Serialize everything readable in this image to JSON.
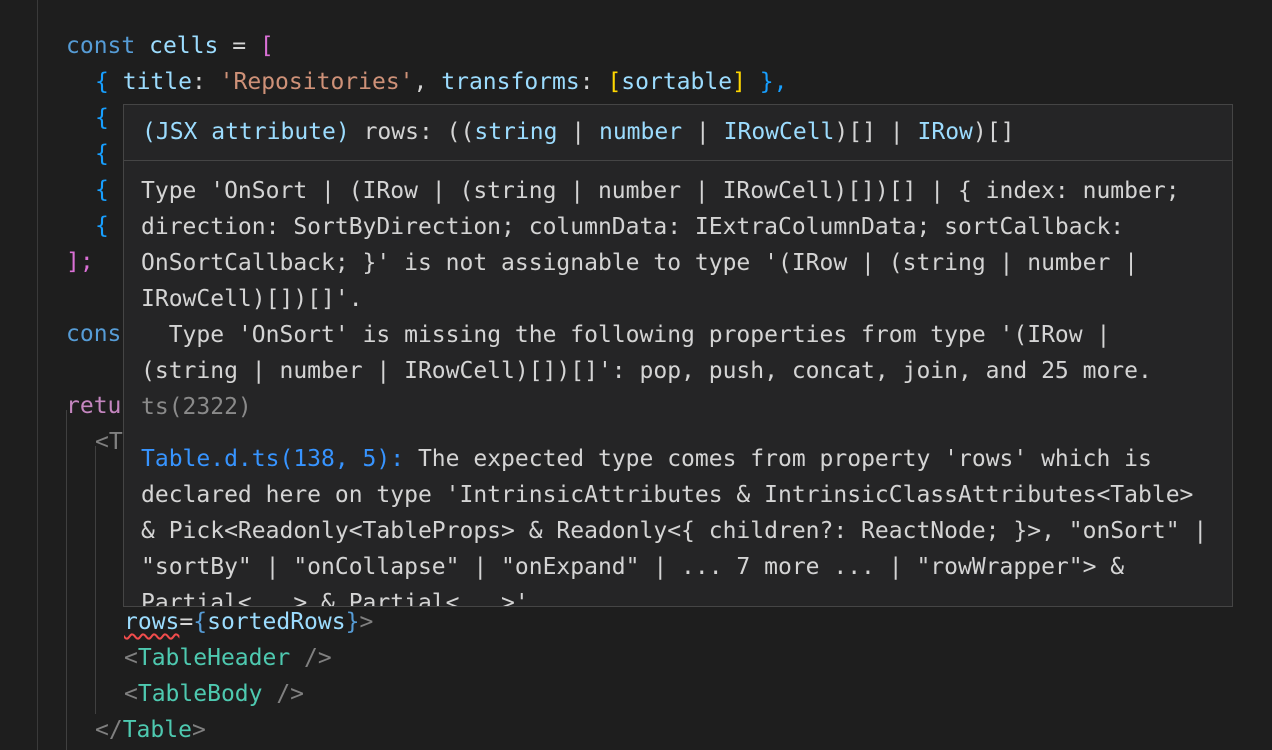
{
  "editor": {
    "line1": {
      "kw": "const",
      "name": "cells",
      "op": " = ",
      "open": "["
    },
    "line2": {
      "open": "{",
      "key1": "title",
      "colon1": ": ",
      "val1": "'Repositories'",
      "comma1": ", ",
      "key2": "transforms",
      "colon2": ": ",
      "arr_open": "[",
      "arr_val": "sortable",
      "arr_close": "]",
      "close": " },"
    },
    "obj_open": "{",
    "line_end": "];",
    "truncated_const": "cons",
    "truncated_return": "retu",
    "truncated_tag": "<T",
    "rows_line": {
      "attr": "rows",
      "eq": "=",
      "open": "{",
      "val": "sortedRows",
      "close": "}",
      "end": ">"
    },
    "header_line": {
      "lt": "<",
      "tag": "TableHeader",
      "end": " />"
    },
    "body_line": {
      "lt": "<",
      "tag": "TableBody",
      "end": " />"
    },
    "close_line": {
      "lt": "</",
      "tag": "Table",
      "end": ">"
    }
  },
  "hover": {
    "signature": {
      "p1": "(JSX attribute) ",
      "p2": "rows",
      "p3": ": ((",
      "t1": "string",
      "p4": " | ",
      "t2": "number",
      "p5": " | ",
      "t3": "IRowCell",
      "p6": ")[] | ",
      "t4": "IRow",
      "p7": ")[]"
    },
    "message": "Type 'OnSort | (IRow | (string | number | IRowCell)[])[] | { index: number; direction: SortByDirection; columnData: IExtraColumnData; sortCallback: OnSortCallback; }' is not assignable to type '(IRow | (string | number | IRowCell)[])[]'.\n  Type 'OnSort' is missing the following properties from type '(IRow | (string | number | IRowCell)[])[]': pop, push, concat, join, and 25 more. ",
    "code": "ts(2322)",
    "related_link": "Table.d.ts(138, 5):",
    "related_text": " The expected type comes from property 'rows' which is declared here on type 'IntrinsicAttributes & IntrinsicClassAttributes<Table> & Pick<Readonly<TableProps> & Readonly<{ children?: ReactNode; }>, \"onSort\" | \"sortBy\" | \"onCollapse\" | \"onExpand\" | ... 7 more ... | \"rowWrapper\"> & Partial<...> & Partial<...>'"
  }
}
